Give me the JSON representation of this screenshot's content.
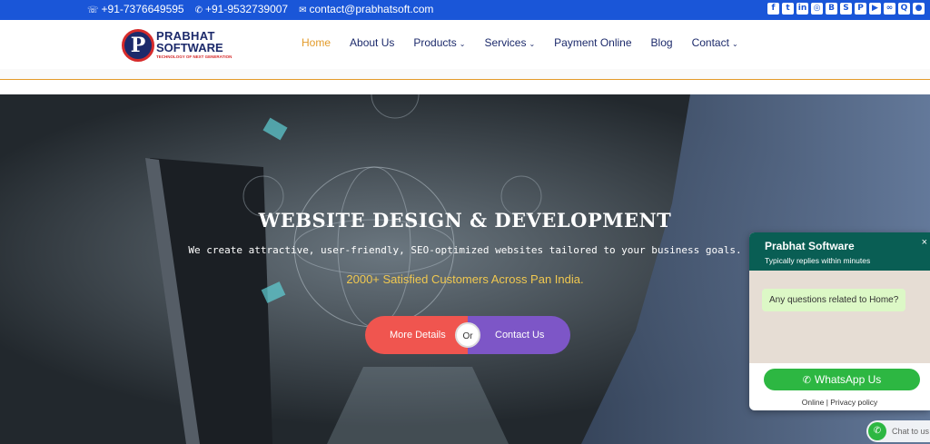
{
  "topbar": {
    "phone1": "+91-7376649595",
    "phone2": "+91-9532739007",
    "email": "contact@prabhatsoft.com",
    "social_icons": [
      "facebook-icon",
      "twitter-icon",
      "linkedin-icon",
      "instagram-icon",
      "blogger-icon",
      "skype-icon",
      "pinterest-icon",
      "youtube-icon",
      "link-icon",
      "quora-icon",
      "medium-icon"
    ],
    "social_glyphs": [
      "f",
      "t",
      "in",
      "◎",
      "B",
      "S",
      "P",
      "▶",
      "∞",
      "Q",
      "●"
    ],
    "bg_color": "#1a56d8"
  },
  "logo": {
    "line1": "PRABHAT",
    "line2": "SOFTWARE",
    "tagline": "TECHNOLOGY OF NEXT GENERATION",
    "mark": "P"
  },
  "nav": {
    "items": [
      {
        "label": "Home",
        "active": true,
        "dropdown": false
      },
      {
        "label": "About Us",
        "active": false,
        "dropdown": false
      },
      {
        "label": "Products",
        "active": false,
        "dropdown": true
      },
      {
        "label": "Services",
        "active": false,
        "dropdown": true
      },
      {
        "label": "Payment Online",
        "active": false,
        "dropdown": false
      },
      {
        "label": "Blog",
        "active": false,
        "dropdown": false
      },
      {
        "label": "Contact",
        "active": false,
        "dropdown": true
      }
    ],
    "active_color": "#e39b2a"
  },
  "hero": {
    "title": "WEBSITE DESIGN & DEVELOPMENT",
    "subtitle": "We create attractive, user-friendly, SEO-optimized websites tailored to your business goals.",
    "customers": "2000+ Satisfied Customers Across Pan India.",
    "more_details": "More Details",
    "or": "Or",
    "contact_us": "Contact Us"
  },
  "whatsapp": {
    "name": "Prabhat Software",
    "status": "Typically replies within minutes",
    "close": "×",
    "message": "Any questions related to Home?",
    "button": "WhatsApp Us",
    "footer": "Online | Privacy policy",
    "chat_label": "Chat to us"
  }
}
